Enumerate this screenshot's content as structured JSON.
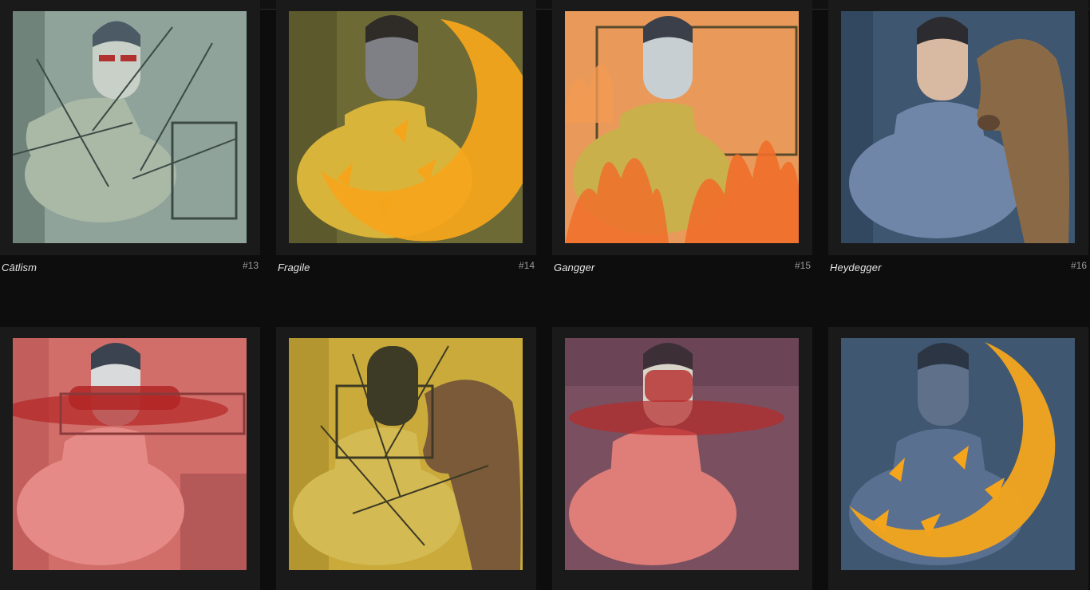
{
  "gallery": {
    "items": [
      {
        "title": "Cātlism",
        "number": "#13",
        "bg": "#8fa39a",
        "figure": "#a9b9a6",
        "accent": "#3c4a46",
        "motif": "arrows"
      },
      {
        "title": "Fragile",
        "number": "#14",
        "bg": "#6d6a36",
        "figure": "#d9b43a",
        "accent": "#f4a51c",
        "motif": "moon"
      },
      {
        "title": "Gangger",
        "number": "#15",
        "bg": "#e99a5a",
        "figure": "#c9b04a",
        "accent": "#f06e2a",
        "motif": "fire"
      },
      {
        "title": "Heydegger",
        "number": "#16",
        "bg": "#3e5670",
        "figure": "#7086a8",
        "accent": "#8a6a46",
        "motif": "dog"
      },
      {
        "title": "",
        "number": "",
        "bg": "#d26e6a",
        "figure": "#e58a86",
        "accent": "#b32626",
        "motif": "hands"
      },
      {
        "title": "",
        "number": "",
        "bg": "#c9aa3a",
        "figure": "#d4ba52",
        "accent": "#3d3a25",
        "motif": "dog-arrows"
      },
      {
        "title": "",
        "number": "",
        "bg": "#7a5060",
        "figure": "#df7d78",
        "accent": "#b72a2a",
        "motif": "hands"
      },
      {
        "title": "",
        "number": "",
        "bg": "#3f5771",
        "figure": "#5a7090",
        "accent": "#f4a51c",
        "motif": "moon"
      }
    ]
  }
}
